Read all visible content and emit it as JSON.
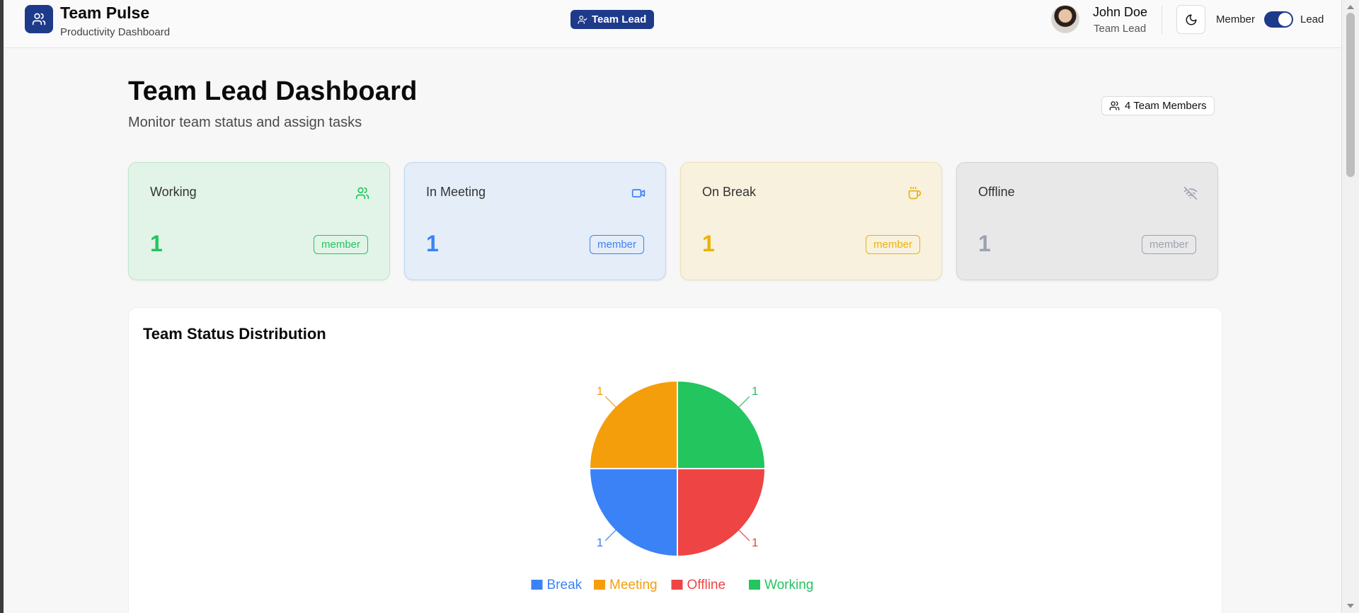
{
  "header": {
    "app_title": "Team Pulse",
    "app_subtitle": "Productivity Dashboard",
    "role_pill": "Team Lead",
    "user_name": "John Doe",
    "user_role": "Team Lead",
    "mode_member_label": "Member",
    "mode_lead_label": "Lead",
    "mode_toggle_on": true,
    "icons": [
      "users-icon",
      "user-check-icon",
      "moon-icon"
    ]
  },
  "main": {
    "title": "Team Lead Dashboard",
    "subtitle": "Monitor team status and assign tasks",
    "member_count": "4 Team Members"
  },
  "cards": [
    {
      "label": "Working",
      "count": "1",
      "badge": "member",
      "icon": "users-icon",
      "color": "#22c55e",
      "bg": "#e2f4e8",
      "border": "#bfe6cc"
    },
    {
      "label": "In Meeting",
      "count": "1",
      "badge": "member",
      "icon": "video-icon",
      "color": "#3b82f6",
      "bg": "#e4edf8",
      "border": "#bcd4f2"
    },
    {
      "label": "On Break",
      "count": "1",
      "badge": "member",
      "icon": "coffee-icon",
      "color": "#eab308",
      "bg": "#f8f1de",
      "border": "#efdfb3"
    },
    {
      "label": "Offline",
      "count": "1",
      "badge": "member",
      "icon": "wifi-off-icon",
      "color": "#9ca3af",
      "bg": "#e8e8e9",
      "border": "#d3d3d6"
    }
  ],
  "chart_title": "Team Status Distribution",
  "chart_data": {
    "type": "pie",
    "title": "Team Status Distribution",
    "slices": [
      {
        "name": "Working",
        "value": 1,
        "color": "#22c55e"
      },
      {
        "name": "Offline",
        "value": 1,
        "color": "#ef4444"
      },
      {
        "name": "Break",
        "value": 1,
        "color": "#3b82f6"
      },
      {
        "name": "Meeting",
        "value": 1,
        "color": "#f59e0b"
      }
    ],
    "legend": [
      {
        "name": "Break",
        "color": "#3b82f6"
      },
      {
        "name": "Meeting",
        "color": "#f59e0b"
      },
      {
        "name": "Offline",
        "color": "#ef4444"
      },
      {
        "name": "Working",
        "color": "#22c55e"
      }
    ],
    "legend_position": "bottom",
    "data_labels": true
  }
}
